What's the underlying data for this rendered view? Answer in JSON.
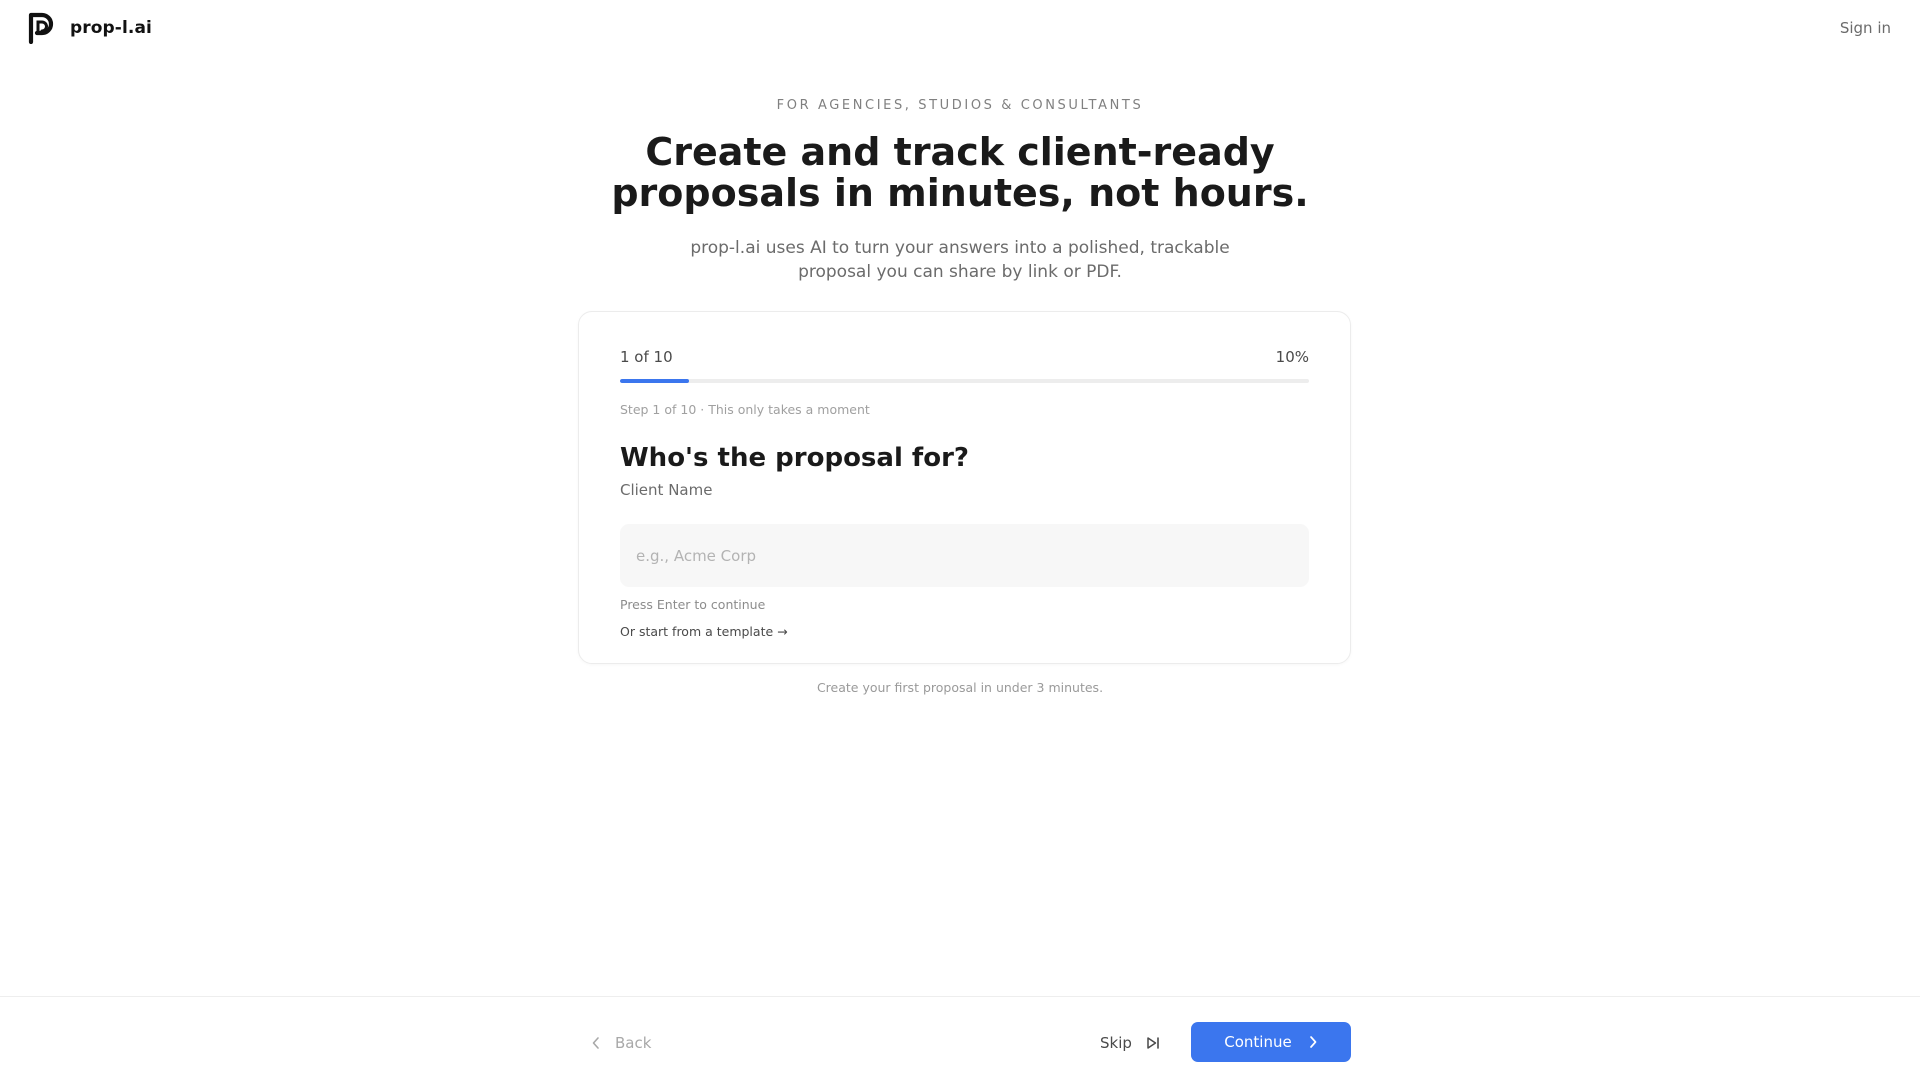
{
  "header": {
    "brand_name": "prop-l.ai",
    "sign_in_label": "Sign in"
  },
  "hero": {
    "eyebrow": "FOR AGENCIES, STUDIOS & CONSULTANTS",
    "headline": "Create and track client-ready proposals in minutes, not hours.",
    "subhead": "prop-l.ai uses AI to turn your answers into a polished, trackable proposal you can share by link or PDF."
  },
  "wizard": {
    "step_counter": "1 of 10",
    "percent_label": "10%",
    "progress_fraction": 0.1,
    "step_note": "Step 1 of 10 · This only takes a moment",
    "question": "Who's the proposal for?",
    "field_label": "Client Name",
    "input_value": "",
    "input_placeholder": "e.g., Acme Corp",
    "hint": "Press Enter to continue",
    "template_link": "Or start from a template →"
  },
  "footnote": "Create your first proposal in under 3 minutes.",
  "nav": {
    "back_label": "Back",
    "skip_label": "Skip",
    "continue_label": "Continue"
  },
  "icons": {
    "brand": "logo-icon",
    "back": "chevron-left-icon",
    "skip": "skip-forward-icon",
    "continue": "chevron-right-icon"
  },
  "colors": {
    "accent": "#3b76ee",
    "text": "#1a1a1a",
    "muted": "#6b6b6b"
  }
}
